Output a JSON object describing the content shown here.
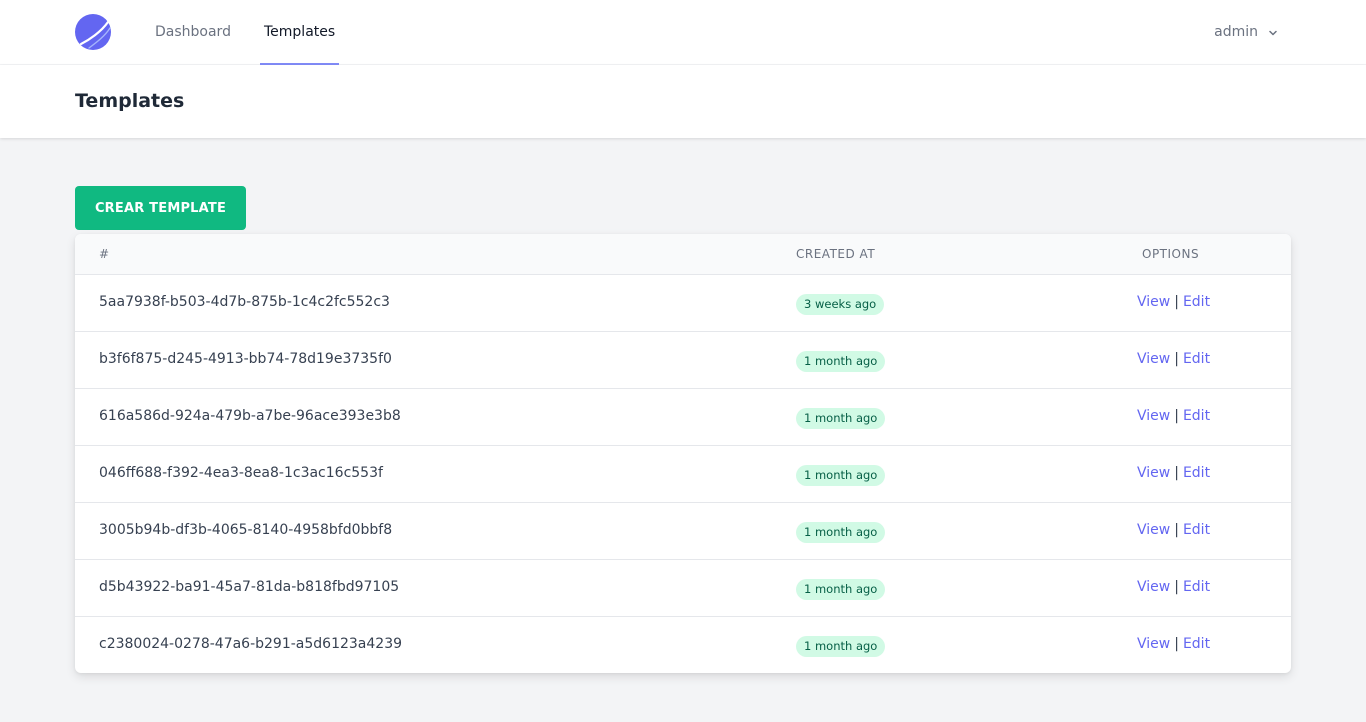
{
  "nav": {
    "links": [
      "Dashboard",
      "Templates"
    ],
    "user": "admin"
  },
  "header": {
    "title": "Templates"
  },
  "actions": {
    "create_label": "CREAR TEMPLATE"
  },
  "table": {
    "columns": [
      "#",
      "CREATED AT",
      "OPTIONS"
    ],
    "rows": [
      {
        "id": "5aa7938f-b503-4d7b-875b-1c4c2fc552c3",
        "created": "3 weeks ago",
        "view": "View",
        "edit": "Edit"
      },
      {
        "id": "b3f6f875-d245-4913-bb74-78d19e3735f0",
        "created": "1 month ago",
        "view": "View",
        "edit": "Edit"
      },
      {
        "id": "616a586d-924a-479b-a7be-96ace393e3b8",
        "created": "1 month ago",
        "view": "View",
        "edit": "Edit"
      },
      {
        "id": "046ff688-f392-4ea3-8ea8-1c3ac16c553f",
        "created": "1 month ago",
        "view": "View",
        "edit": "Edit"
      },
      {
        "id": "3005b94b-df3b-4065-8140-4958bfd0bbf8",
        "created": "1 month ago",
        "view": "View",
        "edit": "Edit"
      },
      {
        "id": "d5b43922-ba91-45a7-81da-b818fbd97105",
        "created": "1 month ago",
        "view": "View",
        "edit": "Edit"
      },
      {
        "id": "c2380024-0278-47a6-b291-a5d6123a4239",
        "created": "1 month ago",
        "view": "View",
        "edit": "Edit"
      }
    ],
    "separator": "|"
  },
  "colors": {
    "accent": "#6366f1",
    "primary_button": "#10b981",
    "badge_bg": "#d1fae5",
    "badge_text": "#065f46"
  },
  "icons": {
    "logo": "logo-icon",
    "user_menu": "chevron-down-icon"
  }
}
